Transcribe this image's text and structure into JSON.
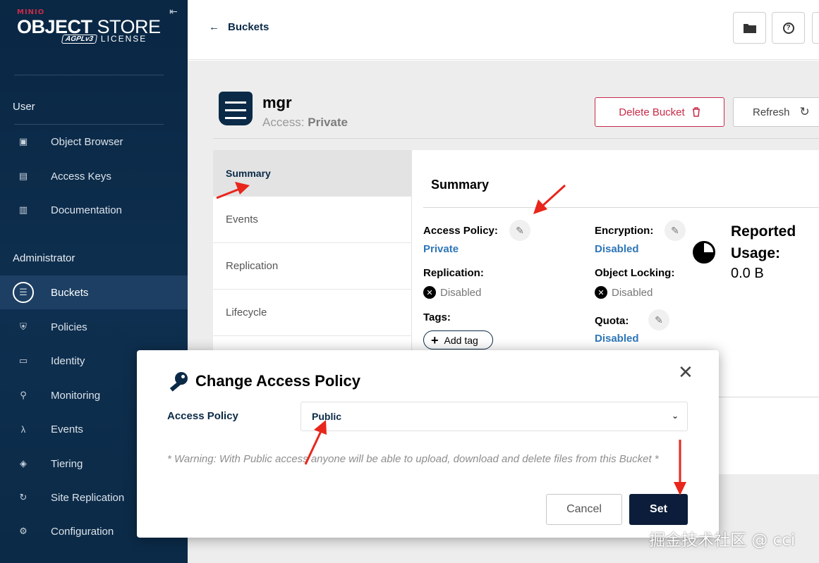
{
  "brand": {
    "minio": "MINIO",
    "title_bold": "OBJECT",
    "title_rest": " STORE",
    "agpl": "AGPLv3",
    "license": "LICENSE"
  },
  "sidebar": {
    "section_user": "User",
    "user_items": [
      {
        "label": "Object Browser",
        "icon": "object-browser-icon"
      },
      {
        "label": "Access Keys",
        "icon": "access-keys-icon"
      },
      {
        "label": "Documentation",
        "icon": "documentation-icon"
      }
    ],
    "section_admin": "Administrator",
    "admin_items": [
      {
        "label": "Buckets",
        "icon": "buckets-icon",
        "active": true
      },
      {
        "label": "Policies",
        "icon": "policies-icon"
      },
      {
        "label": "Identity",
        "icon": "identity-icon"
      },
      {
        "label": "Monitoring",
        "icon": "monitoring-icon"
      },
      {
        "label": "Events",
        "icon": "events-icon"
      },
      {
        "label": "Tiering",
        "icon": "tiering-icon"
      },
      {
        "label": "Site Replication",
        "icon": "site-replication-icon"
      },
      {
        "label": "Configuration",
        "icon": "configuration-icon"
      }
    ]
  },
  "topbar": {
    "back_label": "Buckets"
  },
  "bucket": {
    "name": "mgr",
    "access_prefix": "Access:",
    "access_value": "Private",
    "delete_label": "Delete Bucket",
    "refresh_label": "Refresh"
  },
  "tabs": [
    "Summary",
    "Events",
    "Replication",
    "Lifecycle"
  ],
  "summary": {
    "title": "Summary",
    "access_policy_label": "Access Policy:",
    "access_policy_value": "Private",
    "replication_label": "Replication:",
    "replication_value": "Disabled",
    "tags_label": "Tags:",
    "add_tag_label": "Add tag",
    "encryption_label": "Encryption:",
    "encryption_value": "Disabled",
    "object_locking_label": "Object Locking:",
    "object_locking_value": "Disabled",
    "quota_label": "Quota:",
    "quota_value": "Disabled",
    "reported_usage_label": "Reported Usage:",
    "reported_usage_value": "0.0 B"
  },
  "modal": {
    "title": "Change Access Policy",
    "field_label": "Access Policy",
    "selected_value": "Public",
    "warning": "* Warning: With Public access anyone will be able to upload, download and delete files from this Bucket *",
    "cancel_label": "Cancel",
    "set_label": "Set"
  },
  "watermark": "掘金技术社区 @ cci",
  "colors": {
    "sidebar": "#0a2744",
    "accent": "#c72c48",
    "link": "#2e76b8",
    "primary_button": "#0b1d3a",
    "annotation_arrow": "#e8261c"
  }
}
